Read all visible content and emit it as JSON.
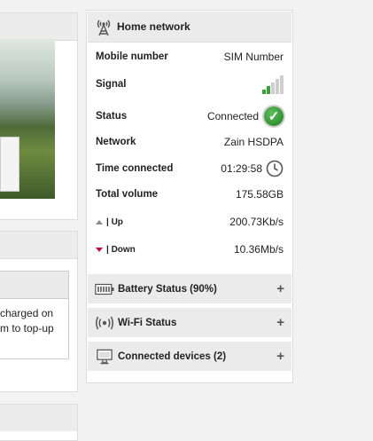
{
  "home_network": {
    "title": "Home network",
    "rows": {
      "mobile_number": {
        "label": "Mobile number",
        "value": "SIM Number"
      },
      "signal": {
        "label": "Signal",
        "bars": 2,
        "bars_total": 5
      },
      "status": {
        "label": "Status",
        "value": "Connected"
      },
      "network": {
        "label": "Network",
        "value": "Zain HSDPA"
      },
      "time_connected": {
        "label": "Time connected",
        "value": "01:29:58"
      },
      "total_volume": {
        "label": "Total volume",
        "value": "175.58GB"
      },
      "up": {
        "label": "| Up",
        "value": "200.73Kb/s"
      },
      "down": {
        "label": "| Down",
        "value": "10.36Mb/s"
      }
    }
  },
  "sections": {
    "battery": {
      "title": "Battery Status (90%)",
      "expand": "+"
    },
    "wifi": {
      "title": "Wi-Fi Status",
      "expand": "+"
    },
    "devices": {
      "title": "Connected devices (2)",
      "expand": "+"
    }
  },
  "left": {
    "message_line1": "charged on",
    "message_line2": "m to top-up"
  },
  "colors": {
    "signal_on": "#3aa335",
    "signal_off": "#cfcfcf",
    "up_arrow": "#8a8a8a",
    "down_arrow": "#c8102e",
    "check": "#1e7d1e"
  }
}
